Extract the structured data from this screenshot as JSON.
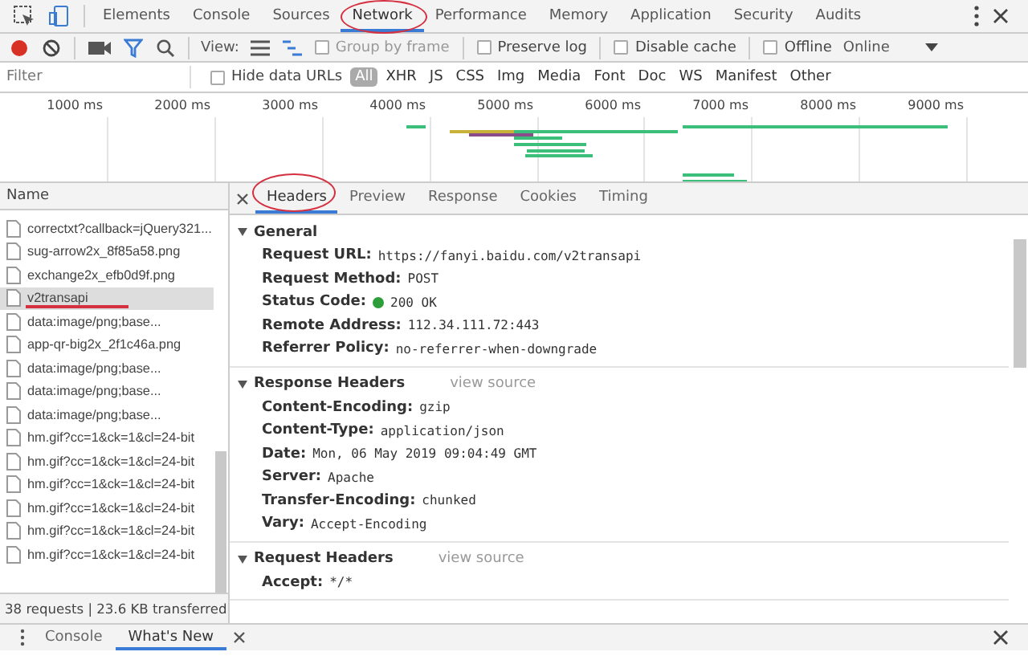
{
  "main_tabs": [
    {
      "label": "Elements",
      "selected": false
    },
    {
      "label": "Console",
      "selected": false
    },
    {
      "label": "Sources",
      "selected": false
    },
    {
      "label": "Network",
      "selected": true
    },
    {
      "label": "Performance",
      "selected": false
    },
    {
      "label": "Memory",
      "selected": false
    },
    {
      "label": "Application",
      "selected": false
    },
    {
      "label": "Security",
      "selected": false
    },
    {
      "label": "Audits",
      "selected": false
    }
  ],
  "toolbar": {
    "view_label": "View:",
    "options": [
      {
        "label": "Group by frame",
        "checked": false,
        "disabled": true
      },
      {
        "label": "Preserve log",
        "checked": false,
        "disabled": false
      },
      {
        "label": "Disable cache",
        "checked": false,
        "disabled": false
      },
      {
        "label": "Offline",
        "checked": false,
        "disabled": false
      }
    ],
    "throttle": "Online"
  },
  "filter_bar": {
    "placeholder": "Filter",
    "hide_data_urls": {
      "label": "Hide data URLs",
      "checked": false
    },
    "types": [
      {
        "label": "All",
        "selected": true
      },
      {
        "label": "XHR",
        "selected": false
      },
      {
        "label": "JS",
        "selected": false
      },
      {
        "label": "CSS",
        "selected": false
      },
      {
        "label": "Img",
        "selected": false
      },
      {
        "label": "Media",
        "selected": false
      },
      {
        "label": "Font",
        "selected": false
      },
      {
        "label": "Doc",
        "selected": false
      },
      {
        "label": "WS",
        "selected": false
      },
      {
        "label": "Manifest",
        "selected": false
      },
      {
        "label": "Other",
        "selected": false
      }
    ]
  },
  "timeline": {
    "ticks": [
      "1000 ms",
      "2000 ms",
      "3000 ms",
      "4000 ms",
      "5000 ms",
      "6000 ms",
      "7000 ms",
      "8000 ms",
      "9000 ms"
    ]
  },
  "requests": {
    "column": "Name",
    "rows": [
      {
        "name": "correctxt?callback=jQuery321...",
        "selected": false
      },
      {
        "name": "sug-arrow2x_8f85a58.png",
        "selected": false
      },
      {
        "name": "exchange2x_efb0d9f.png",
        "selected": false
      },
      {
        "name": "v2transapi",
        "selected": true
      },
      {
        "name": "data:image/png;base...",
        "selected": false
      },
      {
        "name": "app-qr-big2x_2f1c46a.png",
        "selected": false
      },
      {
        "name": "data:image/png;base...",
        "selected": false
      },
      {
        "name": "data:image/png;base...",
        "selected": false
      },
      {
        "name": "data:image/png;base...",
        "selected": false
      },
      {
        "name": "hm.gif?cc=1&ck=1&cl=24-bit",
        "selected": false
      },
      {
        "name": "hm.gif?cc=1&ck=1&cl=24-bit",
        "selected": false
      },
      {
        "name": "hm.gif?cc=1&ck=1&cl=24-bit",
        "selected": false
      },
      {
        "name": "hm.gif?cc=1&ck=1&cl=24-bit",
        "selected": false
      },
      {
        "name": "hm.gif?cc=1&ck=1&cl=24-bit",
        "selected": false
      },
      {
        "name": "hm.gif?cc=1&ck=1&cl=24-bit",
        "selected": false
      }
    ],
    "summary": "38 requests | 23.6 KB transferred"
  },
  "detail_tabs": [
    {
      "label": "Headers",
      "selected": true
    },
    {
      "label": "Preview",
      "selected": false
    },
    {
      "label": "Response",
      "selected": false
    },
    {
      "label": "Cookies",
      "selected": false
    },
    {
      "label": "Timing",
      "selected": false
    }
  ],
  "sections": [
    {
      "title": "General",
      "expanded": true,
      "items": [
        {
          "key": "Request URL:",
          "value": "https://fanyi.baidu.com/v2transapi",
          "status": false
        },
        {
          "key": "Request Method:",
          "value": "POST",
          "status": false
        },
        {
          "key": "Status Code:",
          "value": "200 OK",
          "status": true
        },
        {
          "key": "Remote Address:",
          "value": "112.34.111.72:443",
          "status": false
        },
        {
          "key": "Referrer Policy:",
          "value": "no-referrer-when-downgrade",
          "status": false
        }
      ]
    },
    {
      "title": "Response Headers",
      "link": "view source",
      "expanded": true,
      "items": [
        {
          "key": "Content-Encoding:",
          "value": "gzip",
          "status": false
        },
        {
          "key": "Content-Type:",
          "value": "application/json",
          "status": false
        },
        {
          "key": "Date:",
          "value": "Mon, 06 May 2019 09:04:49 GMT",
          "status": false
        },
        {
          "key": "Server:",
          "value": "Apache",
          "status": false
        },
        {
          "key": "Transfer-Encoding:",
          "value": "chunked",
          "status": false
        },
        {
          "key": "Vary:",
          "value": "Accept-Encoding",
          "status": false
        }
      ]
    },
    {
      "title": "Request Headers",
      "link": "view source",
      "expanded": true,
      "items": [
        {
          "key": "Accept:",
          "value": "*/*",
          "status": false
        }
      ]
    }
  ],
  "drawer_tabs": [
    {
      "label": "Console",
      "selected": false
    },
    {
      "label": "What's New",
      "selected": true
    }
  ]
}
